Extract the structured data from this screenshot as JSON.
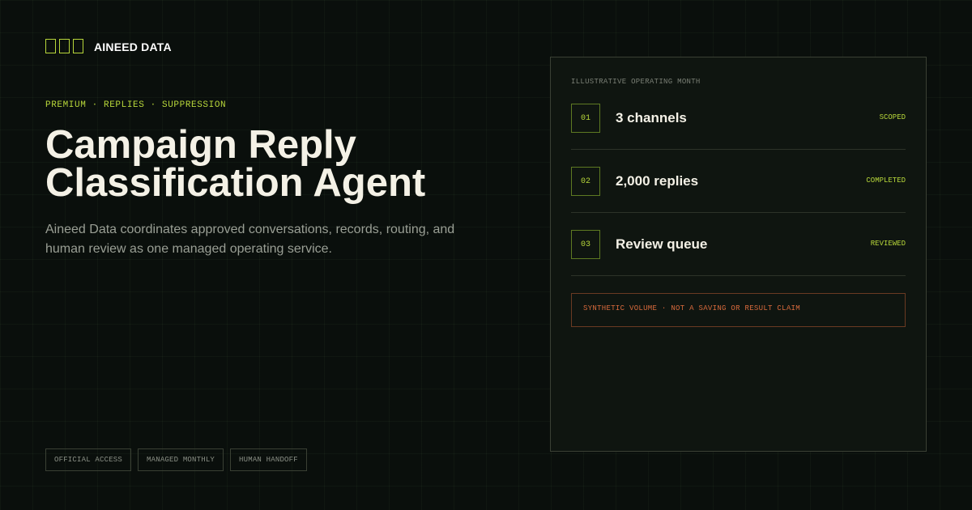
{
  "brand": {
    "name": "AINEED DATA",
    "mark_icon": "three-square-logo-icon"
  },
  "hero": {
    "eyebrow": "PREMIUM · REPLIES · SUPPRESSION",
    "title_line_1": "Campaign Reply",
    "title_line_2": "Classification Agent",
    "subtitle": "Aineed Data coordinates approved conversations, records, routing, and human review as one managed operating service."
  },
  "tags": [
    "OFFICIAL ACCESS",
    "MANAGED MONTHLY",
    "HUMAN HANDOFF"
  ],
  "panel": {
    "label": "ILLUSTRATIVE OPERATING MONTH",
    "rows": [
      {
        "num": "01",
        "label": "3 channels",
        "status": "SCOPED"
      },
      {
        "num": "02",
        "label": "2,000 replies",
        "status": "COMPLETED"
      },
      {
        "num": "03",
        "label": "Review queue",
        "status": "REVIEWED"
      }
    ],
    "disclaimer": "SYNTHETIC VOLUME · NOT A SAVING OR RESULT CLAIM"
  },
  "colors": {
    "background": "#0a0f0c",
    "accent": "#b7d63a",
    "warning": "#d86a3c",
    "text": "#f4f1e6",
    "muted": "#9a9f95"
  }
}
